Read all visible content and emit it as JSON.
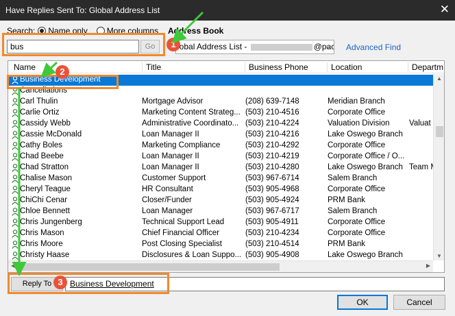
{
  "window": {
    "title": "Have Replies Sent To: Global Address List",
    "close_glyph": "✕"
  },
  "search": {
    "label": "Search:",
    "radio_name_only": "Name only",
    "radio_more_columns": "More columns",
    "selected": "Name only",
    "value": "bus",
    "go_label": "Go"
  },
  "address_book": {
    "label": "Address Book",
    "selected_prefix": "lobal Address List - ",
    "selected_suffix": "@pacresr",
    "advanced_find": "Advanced Find"
  },
  "list": {
    "columns": [
      "Name",
      "Title",
      "Business Phone",
      "Location",
      "Departm"
    ],
    "rows": [
      {
        "name": "Business Development",
        "title": "",
        "phone": "",
        "location": "",
        "dept": "",
        "selected": true
      },
      {
        "name": "Cancellations",
        "title": "",
        "phone": "",
        "location": "",
        "dept": ""
      },
      {
        "name": "Carl Thulin",
        "title": "Mortgage Advisor",
        "phone": "(208) 639-7148",
        "location": "Meridian Branch",
        "dept": ""
      },
      {
        "name": "Carlie Ortiz",
        "title": "Marketing Content Strateg...",
        "phone": "(503) 210-4516",
        "location": "Corporate Office",
        "dept": ""
      },
      {
        "name": "Cassidy Webb",
        "title": "Administrative Coordinato...",
        "phone": "(503) 210-4224",
        "location": "Valuation Division",
        "dept": "Valuat"
      },
      {
        "name": "Cassie McDonald",
        "title": "Loan Manager II",
        "phone": "(503) 210-4216",
        "location": "Lake Oswego Branch",
        "dept": ""
      },
      {
        "name": "Cathy Boles",
        "title": "Marketing Compliance",
        "phone": "(503) 210-4292",
        "location": "Corporate Office",
        "dept": ""
      },
      {
        "name": "Chad Beebe",
        "title": "Loan Manager II",
        "phone": "(503) 210-4219",
        "location": "Corporate Office / O...",
        "dept": ""
      },
      {
        "name": "Chad Stratton",
        "title": "Loan Manager II",
        "phone": "(503) 210-4280",
        "location": "Lake Oswego Branch",
        "dept": "Team M"
      },
      {
        "name": "Chalise Mason",
        "title": "Customer Support",
        "phone": "(503) 967-6714",
        "location": "Salem Branch",
        "dept": ""
      },
      {
        "name": "Cheryl Teague",
        "title": "HR Consultant",
        "phone": "(503) 905-4968",
        "location": "Corporate Office",
        "dept": ""
      },
      {
        "name": "ChiChi Cenar",
        "title": "Closer/Funder",
        "phone": "(503) 905-4924",
        "location": "PRM Bank",
        "dept": ""
      },
      {
        "name": "Chloe Bennett",
        "title": "Loan Manager",
        "phone": "(503) 967-6717",
        "location": "Salem Branch",
        "dept": ""
      },
      {
        "name": "Chris Jungenberg",
        "title": "Technical Support Lead",
        "phone": "(503) 905-4911",
        "location": "Corporate Office",
        "dept": ""
      },
      {
        "name": "Chris Mason",
        "title": "Chief Financial Officer",
        "phone": "(503) 210-4234",
        "location": "Corporate Office",
        "dept": ""
      },
      {
        "name": "Chris Moore",
        "title": "Post Closing Specialist",
        "phone": "(503) 210-4514",
        "location": "PRM Bank",
        "dept": ""
      },
      {
        "name": "Christy Haase",
        "title": "Disclosures & Loan Suppo...",
        "phone": "(503) 905-4908",
        "location": "Lake Oswego Branch",
        "dept": ""
      }
    ]
  },
  "reply_to": {
    "button_label": "Reply To",
    "value": "Business Development"
  },
  "buttons": {
    "ok": "OK",
    "cancel": "Cancel"
  },
  "annotations": {
    "badges": [
      "1",
      "2",
      "3"
    ],
    "highlight_color": "#f0892c",
    "badge_color": "#e8533a",
    "arrow_color": "#3ec93a"
  },
  "colors": {
    "selection": "#0a78d7",
    "link": "#1e63c4",
    "titlebar": "#2b2b2b"
  }
}
